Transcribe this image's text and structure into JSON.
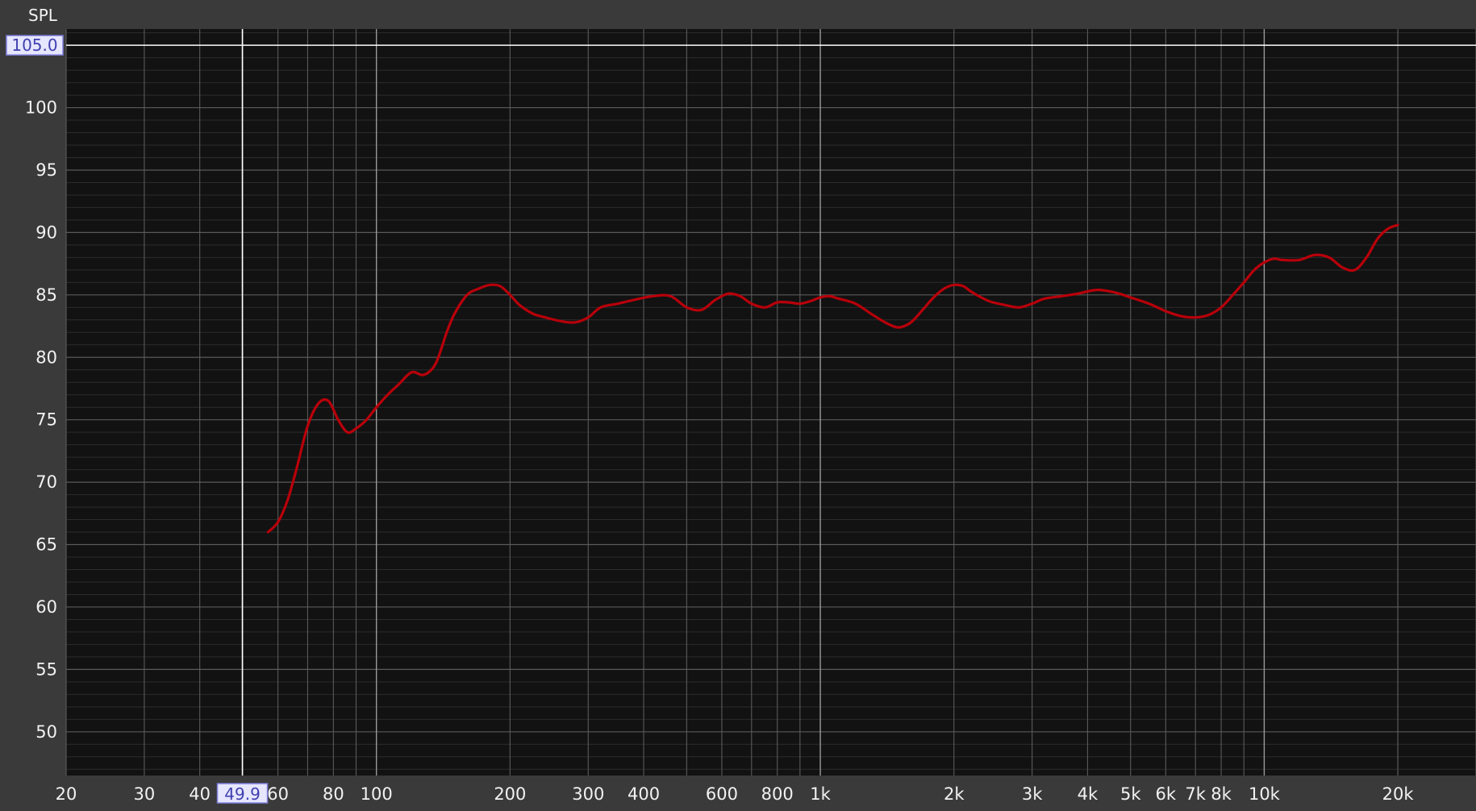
{
  "chart_data": {
    "type": "line",
    "title": "",
    "ylabel": "SPL",
    "xlabel": "",
    "x_scale": "log",
    "xlim": [
      20,
      30000
    ],
    "ylim": [
      46.5,
      106.3
    ],
    "x_ticks": [
      {
        "value": 20,
        "label": "20"
      },
      {
        "value": 30,
        "label": "30"
      },
      {
        "value": 40,
        "label": "40"
      },
      {
        "value": 60,
        "label": "60"
      },
      {
        "value": 80,
        "label": "80"
      },
      {
        "value": 100,
        "label": "100"
      },
      {
        "value": 200,
        "label": "200"
      },
      {
        "value": 300,
        "label": "300"
      },
      {
        "value": 400,
        "label": "400"
      },
      {
        "value": 600,
        "label": "600"
      },
      {
        "value": 800,
        "label": "800"
      },
      {
        "value": 1000,
        "label": "1k"
      },
      {
        "value": 2000,
        "label": "2k"
      },
      {
        "value": 3000,
        "label": "3k"
      },
      {
        "value": 4000,
        "label": "4k"
      },
      {
        "value": 5000,
        "label": "5k"
      },
      {
        "value": 6000,
        "label": "6k"
      },
      {
        "value": 7000,
        "label": "7k"
      },
      {
        "value": 8000,
        "label": "8k"
      },
      {
        "value": 10000,
        "label": "10k"
      },
      {
        "value": 20000,
        "label": "20k"
      }
    ],
    "y_ticks": [
      {
        "value": 50,
        "label": "50"
      },
      {
        "value": 55,
        "label": "55"
      },
      {
        "value": 60,
        "label": "60"
      },
      {
        "value": 65,
        "label": "65"
      },
      {
        "value": 70,
        "label": "70"
      },
      {
        "value": 75,
        "label": "75"
      },
      {
        "value": 80,
        "label": "80"
      },
      {
        "value": 85,
        "label": "85"
      },
      {
        "value": 90,
        "label": "90"
      },
      {
        "value": 95,
        "label": "95"
      },
      {
        "value": 100,
        "label": "100"
      }
    ],
    "cursor": {
      "x": 49.9,
      "y": 105.0,
      "x_label": "49.9",
      "y_label": "105.0"
    },
    "grid": true,
    "colors": {
      "background": "#121212",
      "frame": "#3a3a3a",
      "grid_major": "#5a5a5a",
      "grid_minor": "#2c2c2c",
      "grid_decade": "#9a9a9a",
      "series": "#b8000a",
      "cursor": "#ffffff",
      "cursor_label_bg": "#e6e6ff",
      "cursor_label_border": "#8080e0",
      "cursor_label_text": "#4040b0",
      "text": "#f2f2f2"
    },
    "series": [
      {
        "x": [
          57,
          60,
          63,
          66,
          70,
          74,
          78,
          82,
          86,
          90,
          95,
          100,
          106,
          112,
          120,
          128,
          136,
          144,
          150,
          160,
          170,
          180,
          190,
          200,
          210,
          225,
          240,
          260,
          280,
          300,
          320,
          350,
          380,
          420,
          460,
          500,
          540,
          580,
          620,
          660,
          700,
          750,
          800,
          850,
          900,
          950,
          1000,
          1050,
          1100,
          1200,
          1300,
          1400,
          1500,
          1600,
          1700,
          1800,
          1900,
          2000,
          2100,
          2200,
          2400,
          2600,
          2800,
          3000,
          3200,
          3500,
          3800,
          4200,
          4600,
          5000,
          5500,
          6000,
          6500,
          7000,
          7500,
          8000,
          8500,
          9000,
          9500,
          10000,
          10500,
          11000,
          12000,
          13000,
          14000,
          15000,
          16000,
          17000,
          18000,
          19000,
          20000
        ],
        "y": [
          66.0,
          66.8,
          68.5,
          71.0,
          74.5,
          76.3,
          76.5,
          75.0,
          74.0,
          74.3,
          75.0,
          76.0,
          77.0,
          77.8,
          78.8,
          78.6,
          79.5,
          82.0,
          83.5,
          85.0,
          85.5,
          85.8,
          85.7,
          85.0,
          84.2,
          83.5,
          83.2,
          82.9,
          82.8,
          83.2,
          84.0,
          84.3,
          84.6,
          84.9,
          84.9,
          84.0,
          83.8,
          84.6,
          85.1,
          84.9,
          84.3,
          84.0,
          84.4,
          84.4,
          84.3,
          84.5,
          84.8,
          84.9,
          84.7,
          84.3,
          83.5,
          82.8,
          82.4,
          82.8,
          83.8,
          84.8,
          85.5,
          85.8,
          85.7,
          85.2,
          84.5,
          84.2,
          84.0,
          84.3,
          84.7,
          84.9,
          85.1,
          85.4,
          85.2,
          84.8,
          84.3,
          83.7,
          83.3,
          83.2,
          83.4,
          84.0,
          85.0,
          86.0,
          87.0,
          87.6,
          87.9,
          87.8,
          87.8,
          88.2,
          88.0,
          87.2,
          87.0,
          88.0,
          89.5,
          90.3,
          90.6
        ]
      }
    ]
  }
}
